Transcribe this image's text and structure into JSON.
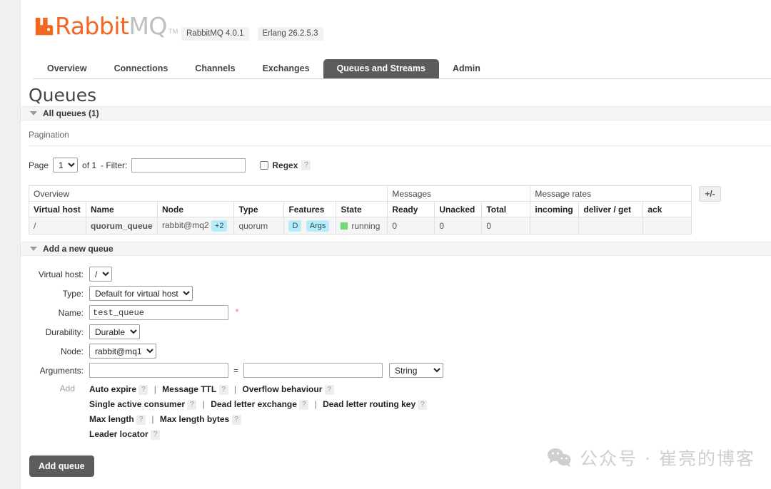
{
  "brand": {
    "logo_rabbit": "Rabbit",
    "logo_mq": "MQ",
    "trademark": "TM",
    "version_rabbitmq": "RabbitMQ 4.0.1",
    "version_erlang": "Erlang 26.2.5.3",
    "logo_color": "#f26822"
  },
  "nav": {
    "tabs": [
      {
        "label": "Overview",
        "active": false
      },
      {
        "label": "Connections",
        "active": false
      },
      {
        "label": "Channels",
        "active": false
      },
      {
        "label": "Exchanges",
        "active": false
      },
      {
        "label": "Queues and Streams",
        "active": true
      },
      {
        "label": "Admin",
        "active": false
      }
    ],
    "active_tab_bg": "#5c5c5c"
  },
  "page": {
    "title": "Queues",
    "all_queues_header": "All queues (1)",
    "pagination_header": "Pagination"
  },
  "pagination": {
    "page_label": "Page",
    "page_value": "1",
    "page_options": [
      "1"
    ],
    "of_label": "of 1",
    "filter_label": "- Filter:",
    "filter_value": "",
    "filter_placeholder": "",
    "regex_label": "Regex",
    "regex_checked": false,
    "help": "?"
  },
  "table": {
    "group_headers": [
      {
        "label": "Overview",
        "span": 6
      },
      {
        "label": "Messages",
        "span": 3
      },
      {
        "label": "Message rates",
        "span": 3
      }
    ],
    "columns": [
      "Virtual host",
      "Name",
      "Node",
      "Type",
      "Features",
      "State",
      "Ready",
      "Unacked",
      "Total",
      "incoming",
      "deliver / get",
      "ack"
    ],
    "rows": [
      {
        "virtual_host": "/",
        "name": "quorum_queue",
        "node": "rabbit@mq2",
        "node_extra": "+2",
        "type": "quorum",
        "features": [
          "D",
          "Args"
        ],
        "state": "running",
        "ready": "0",
        "unacked": "0",
        "total": "0",
        "incoming": "",
        "deliver_get": "",
        "ack": ""
      }
    ],
    "toggle_columns_label": "+/-",
    "state_color": "#6fdc6f",
    "badge_color": "#b7ecfb"
  },
  "add_queue": {
    "section_header": "Add a new queue",
    "fields": {
      "virtual_host_label": "Virtual host:",
      "virtual_host_value": "/",
      "type_label": "Type:",
      "type_value": "Default for virtual host",
      "name_label": "Name:",
      "name_value": "test_queue",
      "name_required_mark": "*",
      "durability_label": "Durability:",
      "durability_value": "Durable",
      "node_label": "Node:",
      "node_value": "rabbit@mq1",
      "arguments_label": "Arguments:",
      "argument_key_value": "",
      "argument_val_value": "",
      "argument_type_value": "String",
      "argument_equals": "=",
      "add_label": "Add"
    },
    "presets": [
      {
        "label": "Auto expire",
        "help": "?"
      },
      {
        "label": "Message TTL",
        "help": "?"
      },
      {
        "label": "Overflow behaviour",
        "help": "?"
      },
      {
        "label": "Single active consumer",
        "help": "?"
      },
      {
        "label": "Dead letter exchange",
        "help": "?"
      },
      {
        "label": "Dead letter routing key",
        "help": "?"
      },
      {
        "label": "Max length",
        "help": "?"
      },
      {
        "label": "Max length bytes",
        "help": "?"
      },
      {
        "label": "Leader locator",
        "help": "?"
      }
    ],
    "submit_label": "Add queue"
  },
  "watermark": {
    "text": "公众号 · 崔亮的博客"
  }
}
